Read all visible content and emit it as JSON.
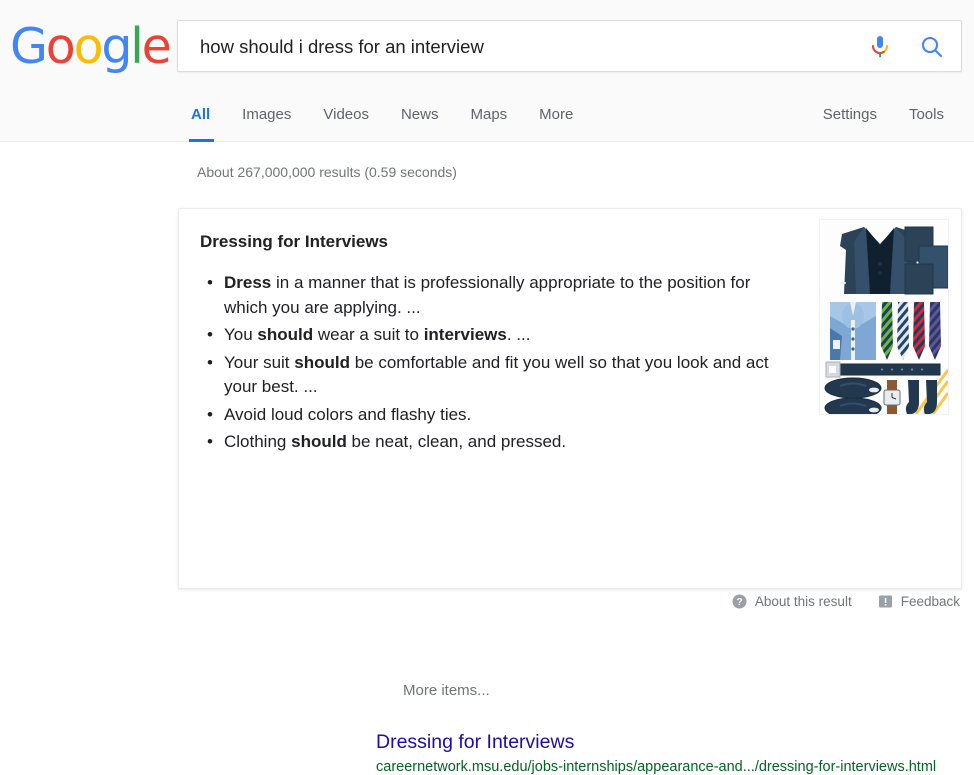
{
  "brand": {
    "name": "Google",
    "letters": [
      {
        "ch": "G",
        "color": "#4285F4"
      },
      {
        "ch": "o",
        "color": "#EA4335"
      },
      {
        "ch": "o",
        "color": "#FBBC05"
      },
      {
        "ch": "g",
        "color": "#4285F4"
      },
      {
        "ch": "l",
        "color": "#34A853"
      },
      {
        "ch": "e",
        "color": "#EA4335"
      }
    ]
  },
  "search": {
    "value": "how should i dress for an interview",
    "placeholder": "Search",
    "mic_icon": "microphone-icon",
    "search_icon": "search-icon"
  },
  "nav": {
    "tabs": [
      {
        "label": "All",
        "active": true
      },
      {
        "label": "Images",
        "active": false
      },
      {
        "label": "Videos",
        "active": false
      },
      {
        "label": "News",
        "active": false
      },
      {
        "label": "Maps",
        "active": false
      },
      {
        "label": "More",
        "active": false
      }
    ],
    "right": [
      {
        "label": "Settings"
      },
      {
        "label": "Tools"
      }
    ],
    "active_color": "#1a73e8"
  },
  "result_stats": "About 267,000,000 results (0.59 seconds)",
  "snippet": {
    "title": "Dressing for Interviews",
    "bullets": [
      [
        {
          "t": "Dress",
          "b": true
        },
        {
          "t": " in a manner that is professionally appropriate to the position for which you are applying. ...",
          "b": false
        }
      ],
      [
        {
          "t": "You ",
          "b": false
        },
        {
          "t": "should",
          "b": true
        },
        {
          "t": " wear a suit to ",
          "b": false
        },
        {
          "t": "interviews",
          "b": true
        },
        {
          "t": ". ...",
          "b": false
        }
      ],
      [
        {
          "t": "Your suit ",
          "b": false
        },
        {
          "t": "should",
          "b": true
        },
        {
          "t": " be comfortable and fit you well so that you look and act your best. ...",
          "b": false
        }
      ],
      [
        {
          "t": "Avoid loud colors and flashy ties.",
          "b": false
        }
      ],
      [
        {
          "t": "Clothing ",
          "b": false
        },
        {
          "t": "should",
          "b": true
        },
        {
          "t": " be neat, clean, and pressed.",
          "b": false
        }
      ]
    ],
    "more_items_label": "More items...",
    "link_title": "Dressing for Interviews",
    "link_url": "careernetwork.msu.edu/jobs-internships/appearance-and.../dressing-for-interviews.html",
    "link_color": "#1a0dab",
    "url_color": "#006621",
    "thumbnail_alt": "business-attire-flatlay-thumbnail"
  },
  "footer": {
    "about": {
      "label": "About this result",
      "icon": "question-circle-icon"
    },
    "feedback": {
      "label": "Feedback",
      "icon": "feedback-flag-icon"
    }
  },
  "colors": {
    "header_bg": "#fafafa",
    "text_primary": "#202124",
    "text_secondary": "#70757a",
    "accent_blue": "#4285F4"
  }
}
